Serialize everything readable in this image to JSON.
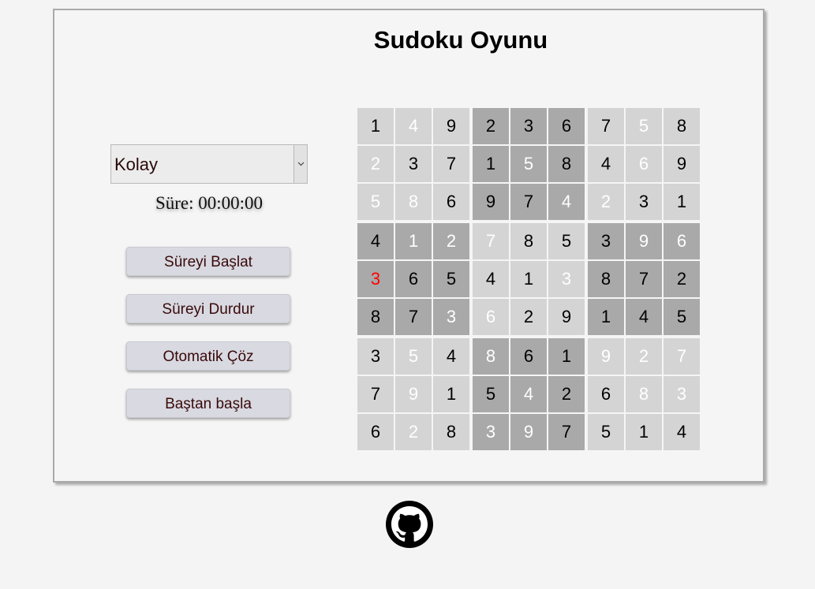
{
  "app": {
    "title": "Sudoku Oyunu",
    "difficulty_selected": "Kolay",
    "timer_text": "Süre: 00:00:00"
  },
  "buttons": {
    "start": "Süreyi Başlat",
    "stop": "Süreyi Durdur",
    "solve": "Otomatik Çöz",
    "restart": "Baştan başla"
  },
  "icons": {
    "dropdown": "chevron-down-icon",
    "footer": "github-icon"
  },
  "colors": {
    "light_block": "#d4d4d4",
    "dark_block": "#a9a9a9",
    "given_digit": "#000000",
    "filled_digit": "#ffffff",
    "error_digit": "#ff0000"
  },
  "board": [
    [
      "1",
      "4",
      "9",
      "2",
      "3",
      "6",
      "7",
      "5",
      "8"
    ],
    [
      "2",
      "3",
      "7",
      "1",
      "5",
      "8",
      "4",
      "6",
      "9"
    ],
    [
      "5",
      "8",
      "6",
      "9",
      "7",
      "4",
      "2",
      "3",
      "1"
    ],
    [
      "4",
      "1",
      "2",
      "7",
      "8",
      "5",
      "3",
      "9",
      "6"
    ],
    [
      "3",
      "6",
      "5",
      "4",
      "1",
      "3",
      "8",
      "7",
      "2"
    ],
    [
      "8",
      "7",
      "3",
      "6",
      "2",
      "9",
      "1",
      "4",
      "5"
    ],
    [
      "3",
      "5",
      "4",
      "8",
      "6",
      "1",
      "9",
      "2",
      "7"
    ],
    [
      "7",
      "9",
      "1",
      "5",
      "4",
      "2",
      "6",
      "8",
      "3"
    ],
    [
      "6",
      "2",
      "8",
      "3",
      "9",
      "7",
      "5",
      "1",
      "4"
    ]
  ],
  "cell_states": [
    [
      "given",
      "empty",
      "given",
      "given",
      "given",
      "given",
      "given",
      "empty",
      "given"
    ],
    [
      "empty",
      "given",
      "given",
      "given",
      "empty",
      "given",
      "given",
      "empty",
      "given"
    ],
    [
      "empty",
      "empty",
      "given",
      "given",
      "given",
      "empty",
      "empty",
      "given",
      "given"
    ],
    [
      "given",
      "empty",
      "empty",
      "empty",
      "given",
      "given",
      "given",
      "empty",
      "empty"
    ],
    [
      "error",
      "given",
      "given",
      "given",
      "given",
      "empty",
      "given",
      "given",
      "given"
    ],
    [
      "given",
      "given",
      "empty",
      "empty",
      "given",
      "given",
      "given",
      "given",
      "given"
    ],
    [
      "given",
      "empty",
      "given",
      "empty",
      "given",
      "given",
      "empty",
      "empty",
      "empty"
    ],
    [
      "given",
      "empty",
      "given",
      "given",
      "empty",
      "given",
      "given",
      "empty",
      "empty"
    ],
    [
      "given",
      "empty",
      "given",
      "empty",
      "empty",
      "given",
      "given",
      "given",
      "given"
    ]
  ]
}
